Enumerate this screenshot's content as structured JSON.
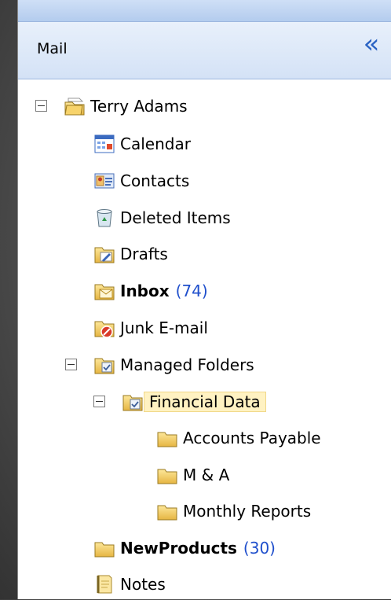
{
  "pane": {
    "title": "Mail",
    "collapse_glyph": "«"
  },
  "tree": {
    "root": {
      "label": "Terry Adams",
      "icon": "mailbox-icon"
    },
    "items": [
      {
        "label": "Calendar",
        "icon": "calendar-icon"
      },
      {
        "label": "Contacts",
        "icon": "contacts-icon"
      },
      {
        "label": "Deleted Items",
        "icon": "deleted-items-icon"
      },
      {
        "label": "Drafts",
        "icon": "drafts-folder-icon"
      },
      {
        "label": "Inbox",
        "count": "(74)",
        "icon": "inbox-folder-icon"
      },
      {
        "label": "Junk E-mail",
        "icon": "junk-folder-icon"
      },
      {
        "label": "Managed Folders",
        "icon": "managed-folder-icon"
      },
      {
        "label": "Financial Data",
        "icon": "managed-folder-icon"
      },
      {
        "label": "Accounts Payable",
        "icon": "folder-icon"
      },
      {
        "label": "M & A",
        "icon": "folder-icon"
      },
      {
        "label": "Monthly Reports",
        "icon": "folder-icon"
      },
      {
        "label": "NewProducts",
        "count": "(30)",
        "icon": "folder-icon"
      },
      {
        "label": "Notes",
        "icon": "notes-icon"
      }
    ]
  },
  "colors": {
    "count": "#1f4fcc",
    "selection_bg": "#fff2c2",
    "accent": "#2a63c4"
  }
}
